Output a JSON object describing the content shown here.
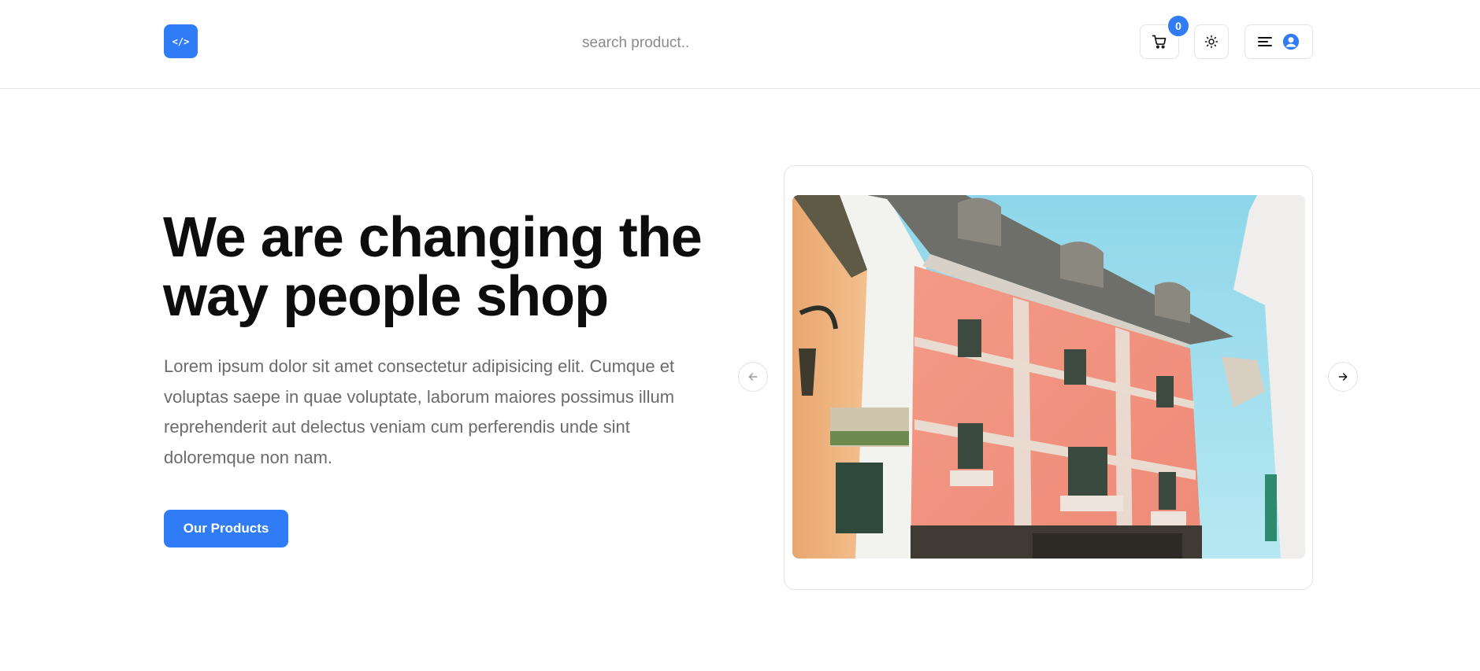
{
  "header": {
    "logo_icon": "code-icon",
    "logo_glyph": "</>",
    "search": {
      "placeholder": "search product..",
      "value": ""
    },
    "cart": {
      "icon": "cart-icon",
      "count": "0"
    },
    "theme_toggle": {
      "icon": "sun-icon"
    },
    "menu": {
      "icons": [
        "menu-icon",
        "user-icon"
      ]
    }
  },
  "hero": {
    "title_line1": "We are changing the",
    "title_line2": "way people shop",
    "description": "Lorem ipsum dolor sit amet consectetur adipisicing elit. Cumque et voluptas saepe in quae voluptate, laborum maiores possimus illum reprehenderit aut delectus veniam cum perferendis unde sint doloremque non nam.",
    "cta_label": "Our Products"
  },
  "carousel": {
    "prev_icon": "arrow-left-icon",
    "next_icon": "arrow-right-icon",
    "image": "pink-building-photo"
  },
  "colors": {
    "accent": "#2f7cf6",
    "text_dark": "#0d0d0d",
    "text_muted": "#6b6b6b",
    "border": "#e3e3e3"
  }
}
